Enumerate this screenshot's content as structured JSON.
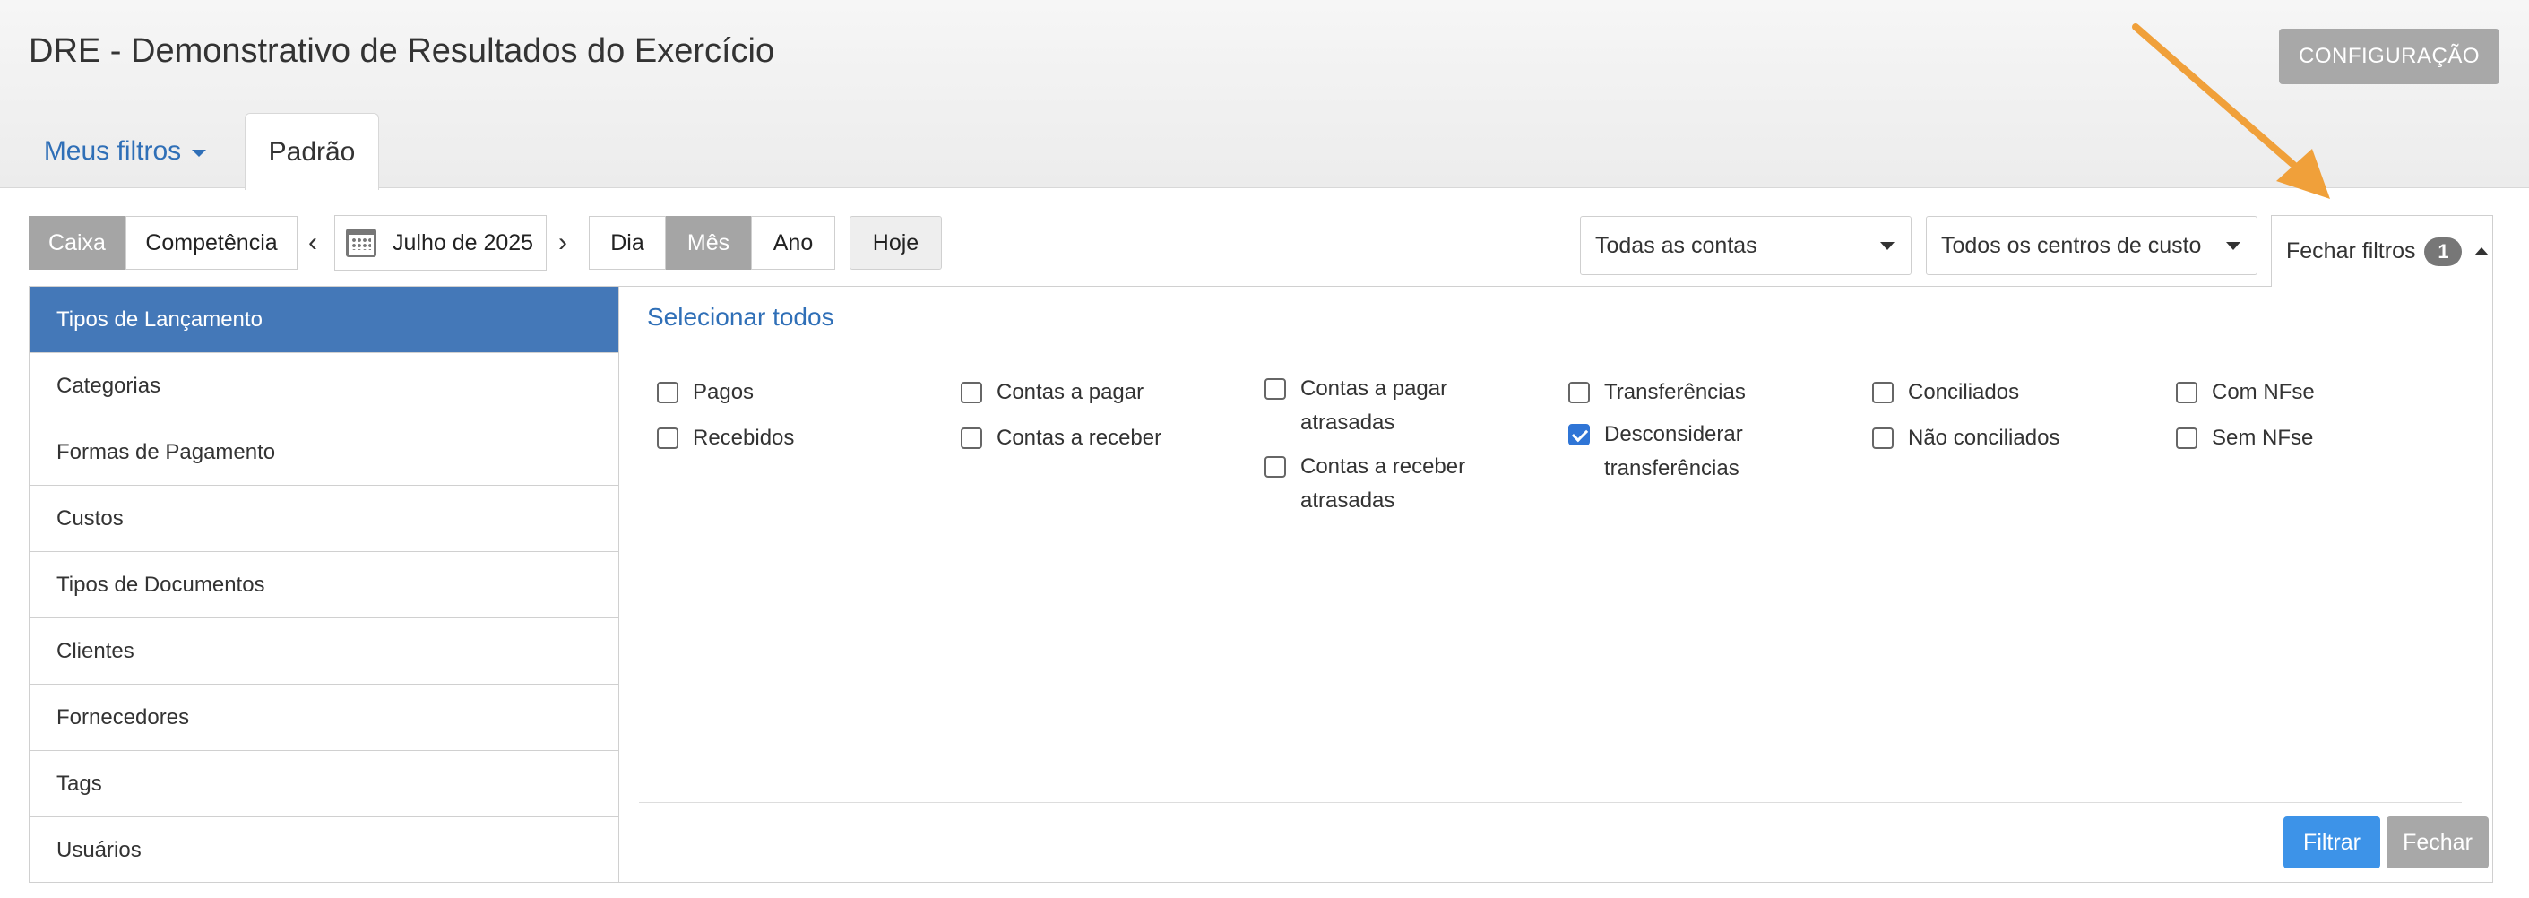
{
  "header": {
    "title": "DRE - Demonstrativo de Resultados do Exercício",
    "config_button": "CONFIGURAÇÃO"
  },
  "tabs": {
    "my_filters": "Meus filtros",
    "default": "Padrão"
  },
  "toolbar": {
    "regime": [
      "Caixa",
      "Competência"
    ],
    "regime_selected": "Caixa",
    "period_label": "Julho de 2025",
    "granularity": [
      "Dia",
      "Mês",
      "Ano"
    ],
    "granularity_selected": "Mês",
    "today": "Hoje",
    "accounts_select": "Todas as contas",
    "cost_centers_select": "Todos os centros de custo",
    "close_filters": "Fechar filtros",
    "active_filter_count": "1"
  },
  "sidebar": {
    "items": [
      "Tipos de Lançamento",
      "Categorias",
      "Formas de Pagamento",
      "Custos",
      "Tipos de Documentos",
      "Clientes",
      "Fornecedores",
      "Tags",
      "Usuários"
    ],
    "active": "Tipos de Lançamento"
  },
  "filters": {
    "select_all": "Selecionar todos",
    "options": {
      "pagos": "Pagos",
      "recebidos": "Recebidos",
      "contas_pagar": "Contas a pagar",
      "contas_receber": "Contas a receber",
      "contas_pagar_atrasadas": "Contas a pagar atrasadas",
      "contas_receber_atrasadas": "Contas a receber atrasadas",
      "transferencias": "Transferências",
      "desconsiderar_transferencias": "Desconsiderar transferências",
      "conciliados": "Conciliados",
      "nao_conciliados": "Não conciliados",
      "com_nfse": "Com NFse",
      "sem_nfse": "Sem NFse"
    },
    "checked": [
      "desconsiderar_transferencias"
    ]
  },
  "actions": {
    "filter": "Filtrar",
    "close": "Fechar"
  },
  "colors": {
    "accent_blue": "#2f6fb7",
    "sidebar_active": "#4478b8",
    "primary_button": "#3d93e8",
    "annotation_arrow": "#f0a03a"
  }
}
